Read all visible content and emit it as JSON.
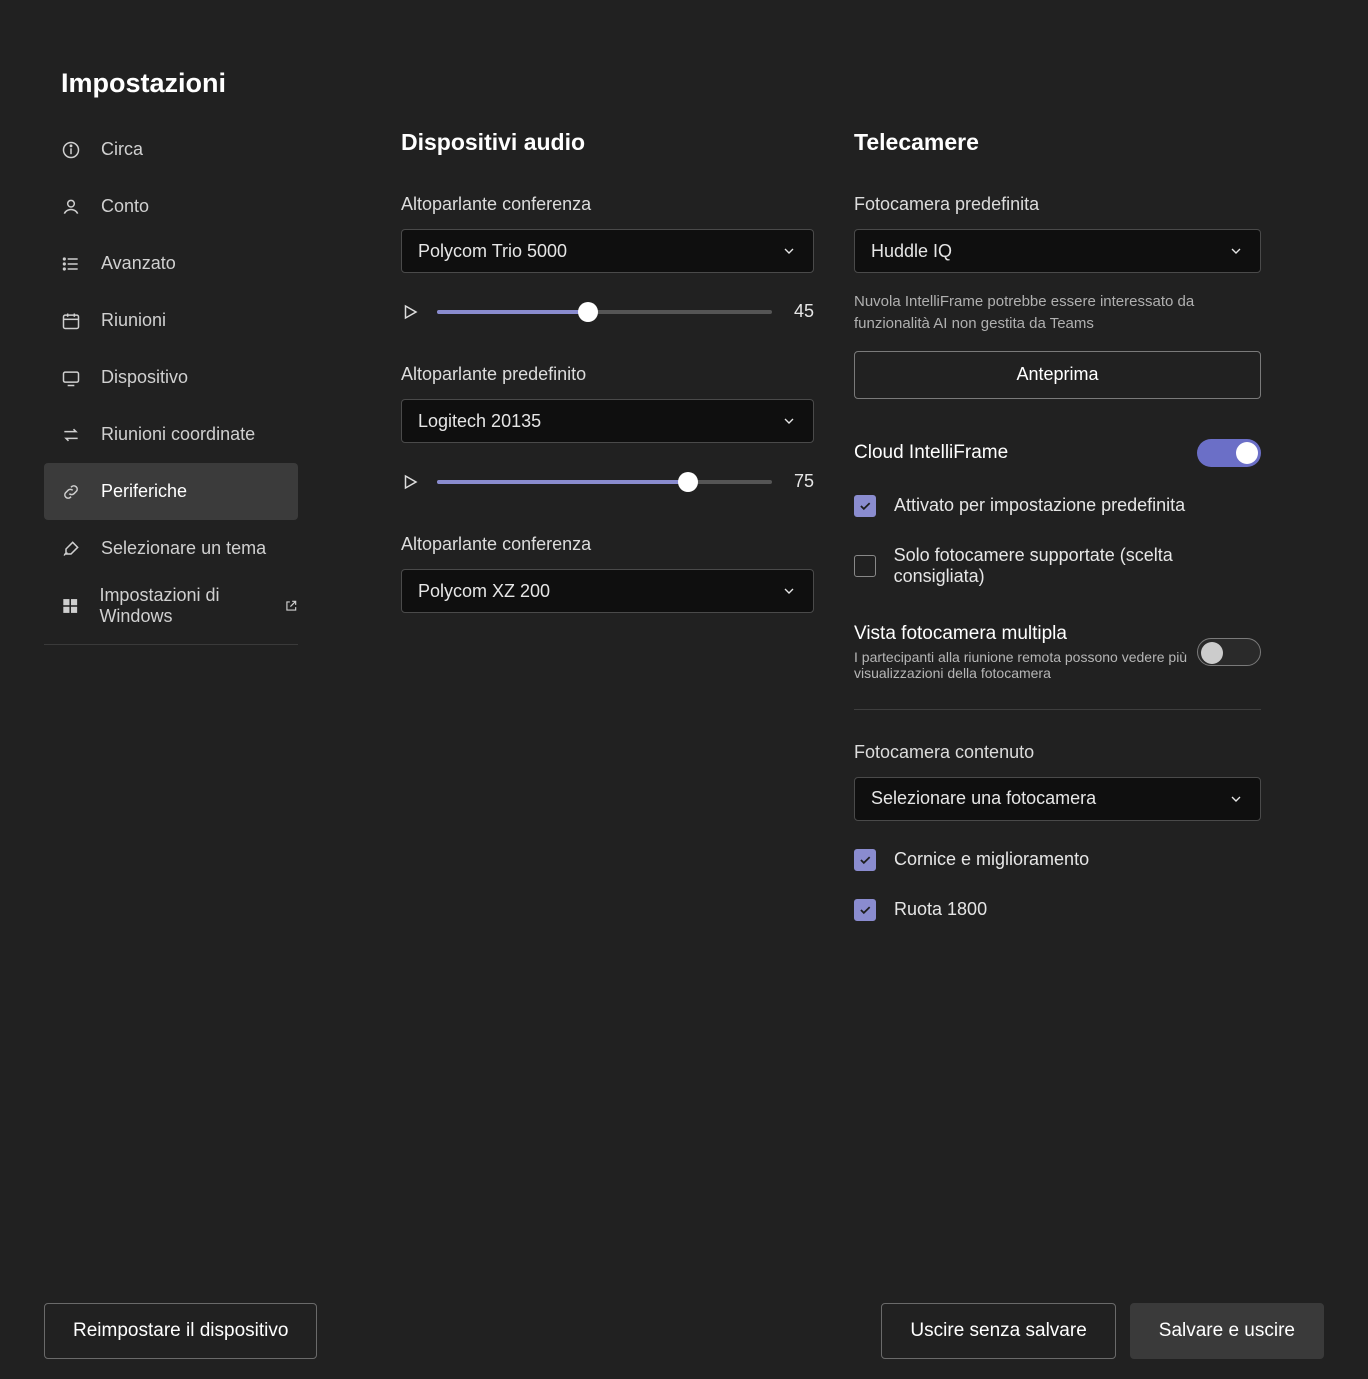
{
  "page": {
    "title": "Impostazioni"
  },
  "sidebar": {
    "items": [
      {
        "label": "Circa"
      },
      {
        "label": "Conto"
      },
      {
        "label": "Avanzato"
      },
      {
        "label": "Riunioni"
      },
      {
        "label": "Dispositivo"
      },
      {
        "label": "Riunioni coordinate"
      },
      {
        "label": "Periferiche"
      },
      {
        "label": "Selezionare un tema"
      },
      {
        "label": "Impostazioni di Windows"
      }
    ],
    "active_index": 6
  },
  "audio": {
    "section_title": "Dispositivi audio",
    "conference_speaker": {
      "label": "Altoparlante conferenza",
      "value": "Polycom Trio 5000",
      "volume": 45
    },
    "default_speaker": {
      "label": "Altoparlante predefinito",
      "value": "Logitech 20135",
      "volume": 75
    },
    "conference_speaker_2": {
      "label": "Altoparlante conferenza",
      "value": "Polycom XZ 200"
    }
  },
  "cameras": {
    "section_title": "Telecamere",
    "default_camera": {
      "label": "Fotocamera predefinita",
      "value": "Huddle IQ"
    },
    "intelliframe_note": "Nuvola IntelliFrame potrebbe essere interessato da funzionalità AI non gestita da Teams",
    "preview_button": "Anteprima",
    "cloud_intelliframe": {
      "title": "Cloud IntelliFrame",
      "enabled": true,
      "enabled_by_default": {
        "label": "Attivato per impostazione predefinita",
        "checked": true
      },
      "supported_only": {
        "label": "Solo fotocamere supportate (scelta consigliata)",
        "checked": false
      }
    },
    "multi_camera_view": {
      "title": "Vista fotocamera multipla",
      "hint": "I partecipanti alla riunione remota possono vedere più visualizzazioni della fotocamera",
      "enabled": false
    },
    "content_camera": {
      "label": "Fotocamera contenuto",
      "value": "Selezionare una fotocamera",
      "frame_enhance": {
        "label": "Cornice e miglioramento",
        "checked": true
      },
      "rotate_1800": {
        "label": "Ruota 1800",
        "checked": true
      }
    }
  },
  "footer": {
    "reset_device": "Reimpostare il dispositivo",
    "exit_no_save": "Uscire senza salvare",
    "save_exit": "Salvare e uscire"
  }
}
